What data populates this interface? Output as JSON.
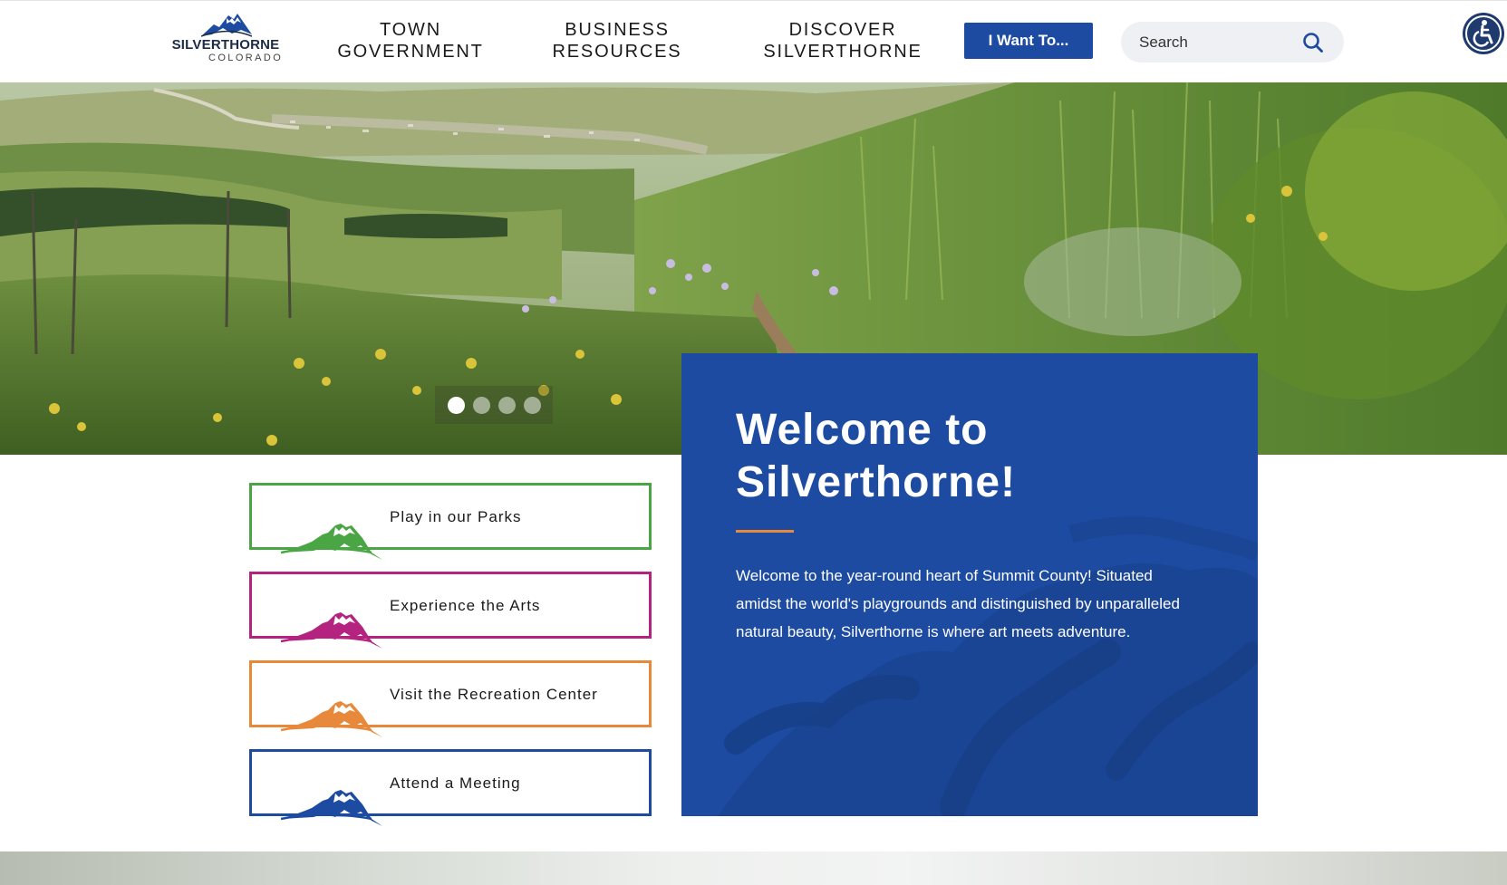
{
  "header": {
    "logo_name": "SILVERTHORNE",
    "logo_sub": "COLORADO",
    "nav": [
      {
        "line1": "TOWN",
        "line2": "GOVERNMENT"
      },
      {
        "line1": "BUSINESS",
        "line2": "RESOURCES"
      },
      {
        "line1": "DISCOVER",
        "line2": "SILVERTHORNE"
      }
    ],
    "want_button": "I Want To...",
    "search_placeholder": "Search"
  },
  "hero": {
    "slides": 4,
    "active_slide": 1
  },
  "welcome": {
    "title_line1": "Welcome to",
    "title_line2": "Silverthorne!",
    "body": "Welcome to the year-round heart of Summit County! Situated amidst the world's playgrounds and distinguished by unparalleled natural beauty, Silverthorne is where art meets adventure."
  },
  "quick_links": [
    {
      "label": "Play in our Parks",
      "color": "#4aa544"
    },
    {
      "label": "Experience the Arts",
      "color": "#b3237f"
    },
    {
      "label": "Visit the Recreation Center",
      "color": "#e8883a"
    },
    {
      "label": "Attend a Meeting",
      "color": "#1d4ba1"
    }
  ],
  "colors": {
    "brand_blue": "#1d4ba1",
    "accent_orange": "#e8883a"
  },
  "icons": [
    "search-icon",
    "accessibility-icon",
    "mountain-logo-icon"
  ]
}
